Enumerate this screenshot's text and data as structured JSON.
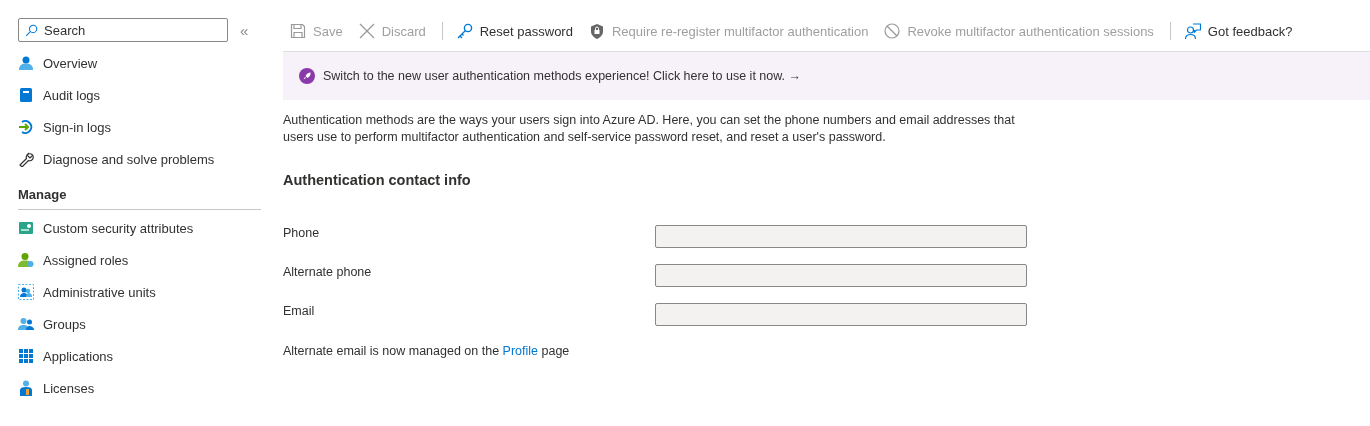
{
  "sidebar": {
    "search": {
      "placeholder": "Search"
    },
    "collapse": "«",
    "items": [
      {
        "label": "Overview"
      },
      {
        "label": "Audit logs"
      },
      {
        "label": "Sign-in logs"
      },
      {
        "label": "Diagnose and solve problems"
      }
    ],
    "section": "Manage",
    "manage_items": [
      {
        "label": "Custom security attributes"
      },
      {
        "label": "Assigned roles"
      },
      {
        "label": "Administrative units"
      },
      {
        "label": "Groups"
      },
      {
        "label": "Applications"
      },
      {
        "label": "Licenses"
      }
    ]
  },
  "toolbar_groups": [
    [
      {
        "label": "Save",
        "disabled": true
      },
      {
        "label": "Discard",
        "disabled": true
      }
    ],
    [
      {
        "label": "Reset password",
        "disabled": false
      },
      {
        "label": "Require re-register multifactor authentication",
        "disabled": true
      },
      {
        "label": "Revoke multifactor authentication sessions",
        "disabled": true
      }
    ],
    [
      {
        "label": "Got feedback?",
        "disabled": false
      }
    ]
  ],
  "banner": {
    "text": "Switch to the new user authentication methods experience! Click here to use it now.",
    "arrow": "→"
  },
  "description": "Authentication methods are the ways your users sign into Azure AD. Here, you can set the phone numbers and email addresses that users use to perform multifactor authentication and self-service password reset, and reset a user's password.",
  "section_title": "Authentication contact info",
  "fields": [
    {
      "label": "Phone"
    },
    {
      "label": "Alternate phone"
    },
    {
      "label": "Email"
    }
  ],
  "note": {
    "before": "Alternate email is now managed on the ",
    "link": "Profile",
    "after": " page"
  }
}
